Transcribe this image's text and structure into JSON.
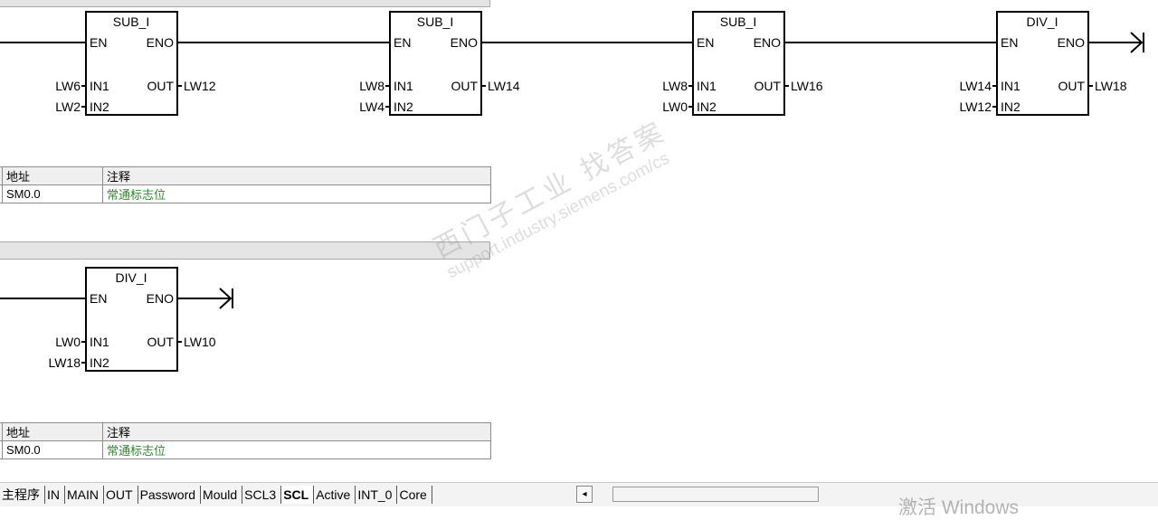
{
  "networks": [
    {
      "boxes": [
        {
          "title": "SUB_I",
          "en": "EN",
          "eno": "ENO",
          "in1_label": "IN1",
          "in2_label": "IN2",
          "out_label": "OUT",
          "in1": "LW6",
          "in2": "LW2",
          "out": "LW12"
        },
        {
          "title": "SUB_I",
          "en": "EN",
          "eno": "ENO",
          "in1_label": "IN1",
          "in2_label": "IN2",
          "out_label": "OUT",
          "in1": "LW8",
          "in2": "LW4",
          "out": "LW14"
        },
        {
          "title": "SUB_I",
          "en": "EN",
          "eno": "ENO",
          "in1_label": "IN1",
          "in2_label": "IN2",
          "out_label": "OUT",
          "in1": "LW8",
          "in2": "LW0",
          "out": "LW16"
        },
        {
          "title": "DIV_I",
          "en": "EN",
          "eno": "ENO",
          "in1_label": "IN1",
          "in2_label": "IN2",
          "out_label": "OUT",
          "in1": "LW14",
          "in2": "LW12",
          "out": "LW18"
        }
      ],
      "symbol_table": {
        "header_address": "地址",
        "header_comment": "注释",
        "address": "SM0.0",
        "comment": "常通标志位"
      }
    },
    {
      "boxes": [
        {
          "title": "DIV_I",
          "en": "EN",
          "eno": "ENO",
          "in1_label": "IN1",
          "in2_label": "IN2",
          "out_label": "OUT",
          "in1": "LW0",
          "in2": "LW18",
          "out": "LW10"
        }
      ],
      "symbol_table": {
        "header_address": "地址",
        "header_comment": "注释",
        "address": "SM0.0",
        "comment": "常通标志位"
      }
    }
  ],
  "tabs": [
    {
      "label": "主程序",
      "active": false
    },
    {
      "label": "IN",
      "active": false
    },
    {
      "label": "MAIN",
      "active": false
    },
    {
      "label": "OUT",
      "active": false
    },
    {
      "label": "Password",
      "active": false
    },
    {
      "label": "Mould",
      "active": false
    },
    {
      "label": "SCL3",
      "active": false
    },
    {
      "label": "SCL",
      "active": true
    },
    {
      "label": "Active",
      "active": false
    },
    {
      "label": "INT_0",
      "active": false
    },
    {
      "label": "Core",
      "active": false
    }
  ],
  "scroll_left_icon": "◂",
  "watermark": {
    "cn": "西门子工业  找答案",
    "url": "support.industry.siemens.com/cs"
  },
  "os_overlay": {
    "activate_text": "激活 Windows"
  },
  "colors": {
    "comment_text": "#2e8b2e",
    "header_bar": "#e4e4e4",
    "table_header": "#efefef"
  }
}
